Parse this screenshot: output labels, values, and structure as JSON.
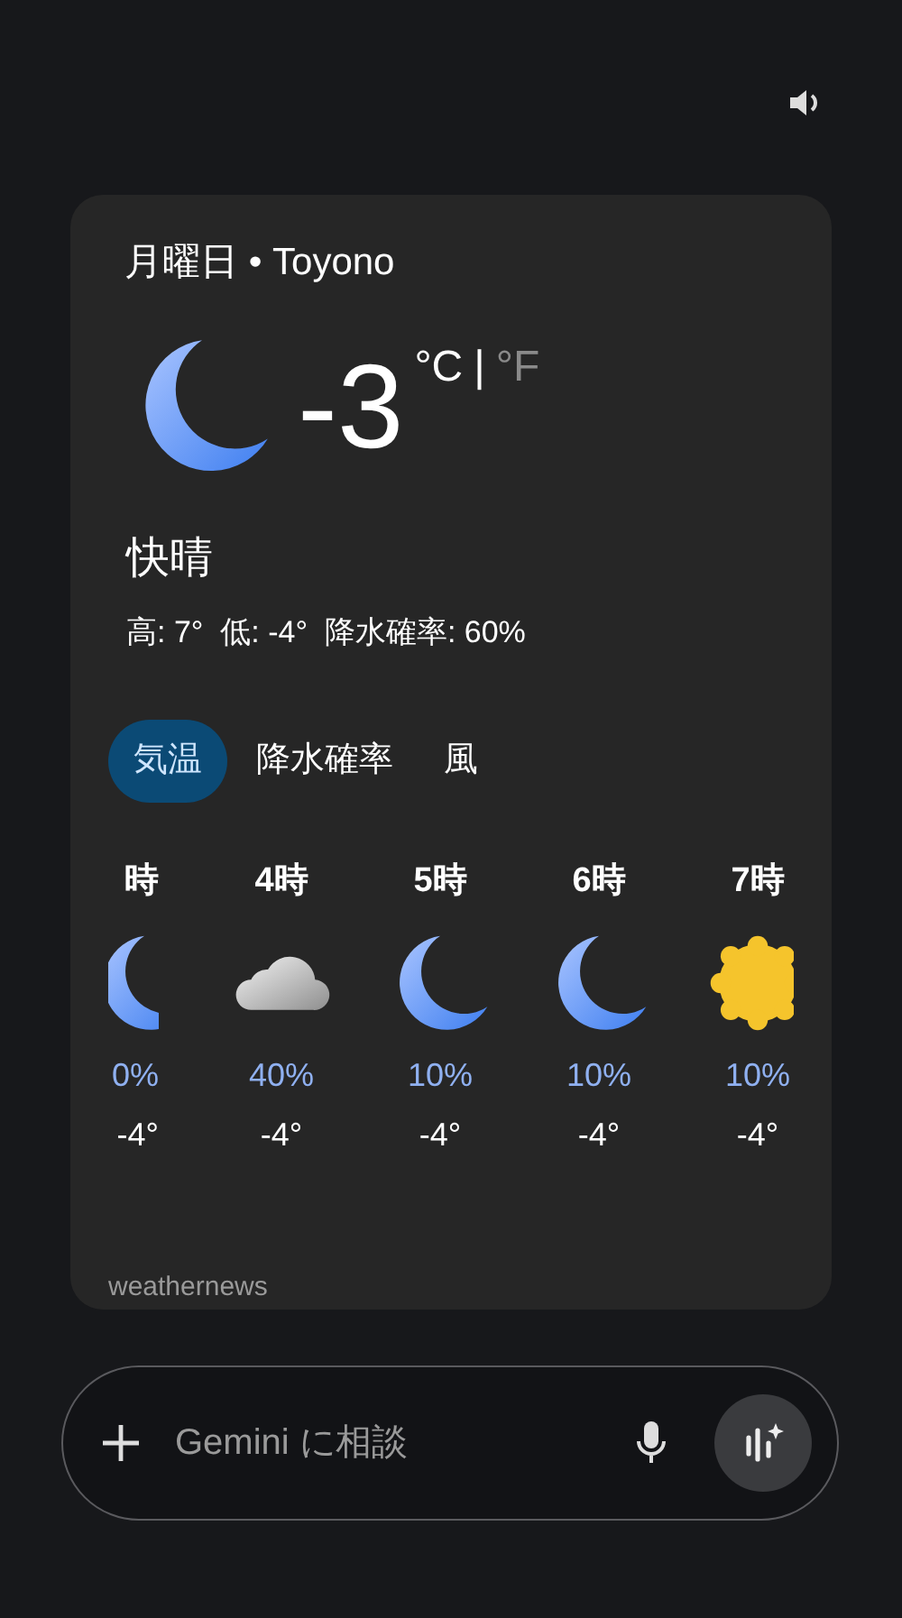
{
  "header": {
    "day_location": "月曜日 • Toyono"
  },
  "current": {
    "kind": "moon",
    "temperature": "-3",
    "units": [
      {
        "label": "°C",
        "selected": true
      },
      {
        "label": "°F",
        "selected": false
      }
    ],
    "separator": "|",
    "condition": "快晴",
    "details": "高: 7°  低: -4°  降水確率: 60%"
  },
  "tabs": [
    {
      "label": "気温",
      "selected": true
    },
    {
      "label": "降水確率",
      "selected": false
    },
    {
      "label": "風",
      "selected": false
    }
  ],
  "hours": [
    {
      "time": "時",
      "kind": "moon",
      "precip": "0%",
      "temp": "-4°",
      "partial": true
    },
    {
      "time": "4時",
      "kind": "cloud",
      "precip": "40%",
      "temp": "-4°",
      "partial": false
    },
    {
      "time": "5時",
      "kind": "moon",
      "precip": "10%",
      "temp": "-4°",
      "partial": false
    },
    {
      "time": "6時",
      "kind": "moon",
      "precip": "10%",
      "temp": "-4°",
      "partial": false
    },
    {
      "time": "7時",
      "kind": "sun",
      "precip": "10%",
      "temp": "-4°",
      "partial": false
    }
  ],
  "source": "weathernews",
  "input": {
    "placeholder": "Gemini に相談"
  }
}
